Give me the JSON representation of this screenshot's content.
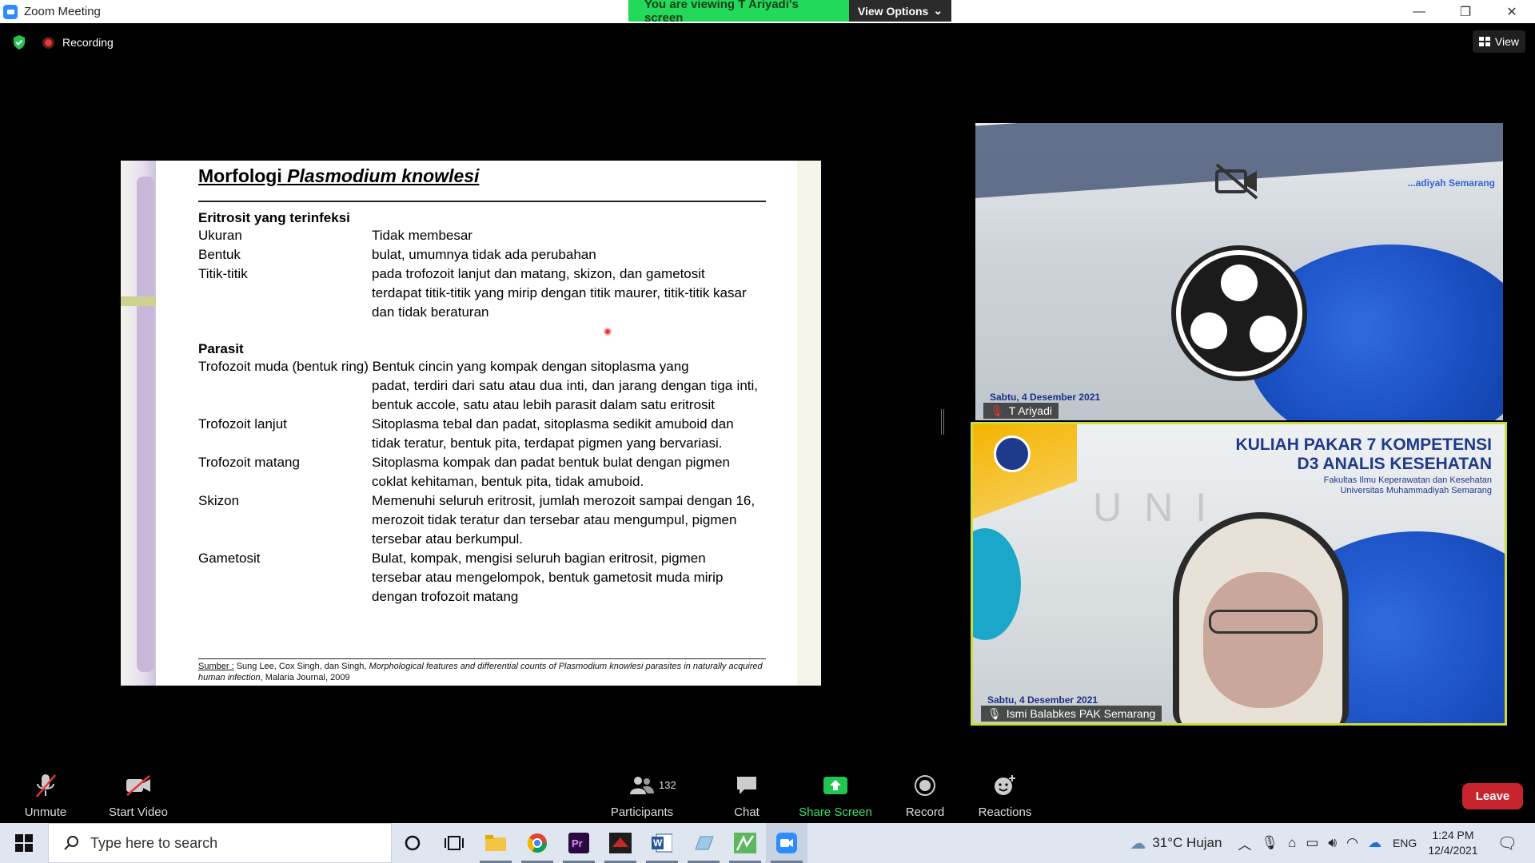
{
  "window": {
    "title": "Zoom Meeting",
    "controls": [
      "—",
      "❐",
      "✕"
    ]
  },
  "banner": {
    "viewing_text": "You are viewing T Ariyadi's screen",
    "options_label": "View Options"
  },
  "status": {
    "recording_label": "Recording",
    "view_label": "View"
  },
  "slide": {
    "title_plain": "Morfologi ",
    "title_italic": "Plasmodium knowlesi",
    "section1": "Eritrosit yang terinfeksi",
    "rows1": [
      {
        "k": "Ukuran",
        "v": "Tidak membesar"
      },
      {
        "k": "Bentuk",
        "v": "bulat, umumnya tidak ada perubahan"
      },
      {
        "k": "Titik-titik",
        "v": "pada trofozoit lanjut dan matang, skizon, dan gametosit terdapat titik-titik yang mirip dengan titik maurer, titik-titik kasar dan tidak beraturan"
      }
    ],
    "section2": "Parasit",
    "rows2": [
      {
        "k": "Trofozoit muda (bentuk ring)",
        "v_inline": "Bentuk cincin yang kompak dengan sitoplasma yang",
        "v": "padat, terdiri dari satu atau dua inti, dan jarang dengan tiga inti, bentuk accole, satu atau lebih parasit dalam satu eritrosit"
      },
      {
        "k": "Trofozoit lanjut",
        "v": "Sitoplasma tebal dan padat, sitoplasma sedikit amuboid dan tidak teratur, bentuk pita, terdapat pigmen yang bervariasi."
      },
      {
        "k": "Trofozoit matang",
        "v": "Sitoplasma kompak dan padat bentuk bulat dengan pigmen coklat kehitaman, bentuk pita, tidak amuboid."
      },
      {
        "k": "Skizon",
        "v": "Memenuhi seluruh eritrosit, jumlah merozoit sampai dengan 16, merozoit tidak teratur dan tersebar atau mengumpul, pigmen tersebar atau berkumpul."
      },
      {
        "k": "Gametosit",
        "v": "Bulat, kompak, mengisi seluruh bagian eritrosit, pigmen tersebar atau mengelompok, bentuk gametosit muda mirip dengan trofozoit matang"
      }
    ],
    "source_label": "Sumber :",
    "source_authors": " Sung Lee, Cox Singh, dan Singh, ",
    "source_italic": "Morphological features and differential counts of Plasmodium knowlesi parasites in naturally acquired human infection",
    "source_tail": ", Malaria Journal, 2009"
  },
  "tiles": [
    {
      "name": "T Ariyadi",
      "corner_text": "...adiyah Semarang",
      "date_text": "Sabtu, 4 Desember 2021"
    },
    {
      "name": "Ismi Balabkes PAK Semarang",
      "heading1": "KULIAH PAKAR 7 KOMPETENSI",
      "heading2": "D3 ANALIS KESEHATAN",
      "subheading1": "Fakultas Ilmu Keperawatan dan Kesehatan",
      "subheading2": "Universitas Muhammadiyah Semarang",
      "watermark": "UNI",
      "date_text": "Sabtu, 4 Desember 2021"
    }
  ],
  "controls": {
    "unmute": "Unmute",
    "start_video": "Start Video",
    "participants": "Participants",
    "participant_count": "132",
    "chat": "Chat",
    "share_screen": "Share Screen",
    "record": "Record",
    "reactions": "Reactions",
    "leave": "Leave"
  },
  "taskbar": {
    "search_placeholder": "Type here to search",
    "weather": "31°C  Hujan",
    "lang": "ENG",
    "time": "1:24 PM",
    "date": "12/4/2021"
  },
  "colors": {
    "zoom_blue": "#2d8cff",
    "banner_green": "#23d959",
    "leave_red": "#c7232d",
    "share_green": "#2fe06b"
  }
}
